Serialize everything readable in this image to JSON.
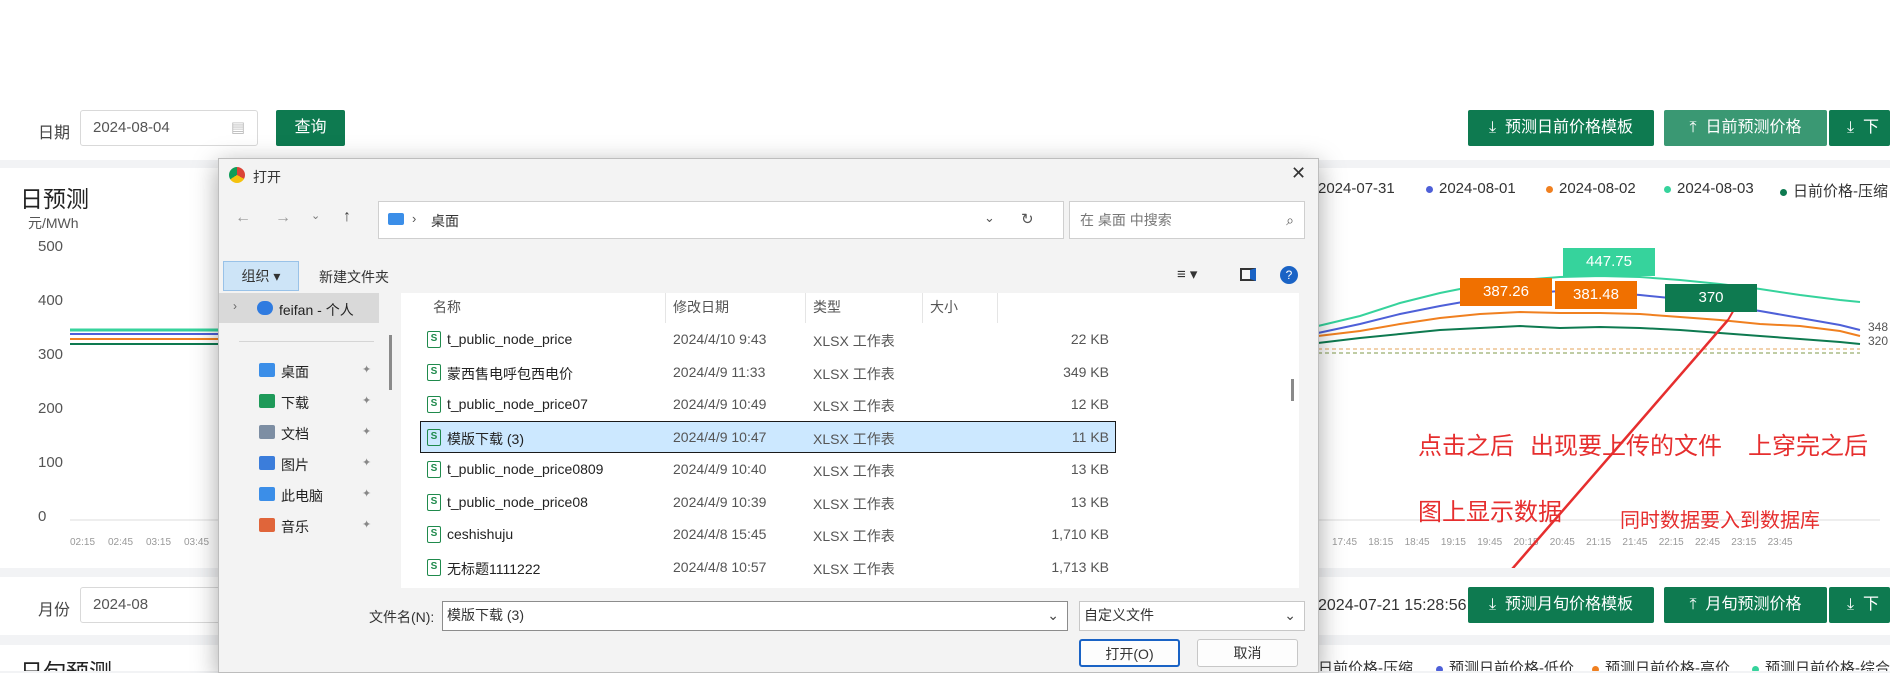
{
  "top": {
    "date_label": "日期",
    "date_value": "2024-08-04",
    "query_label": "查询",
    "btn_template": "预测日前价格模板",
    "btn_predict": "日前预测价格",
    "btn_more": "下"
  },
  "chart1": {
    "title": "日预测",
    "unit": "元/MWh",
    "y_ticks": [
      "500",
      "400",
      "300",
      "200",
      "100",
      "0"
    ],
    "x_ticks_left": [
      "02:15",
      "02:45",
      "03:15",
      "03:45"
    ],
    "x_ticks_right": [
      "17:45",
      "18:15",
      "18:45",
      "19:15",
      "19:45",
      "20:15",
      "20:45",
      "21:15",
      "21:45",
      "22:15",
      "22:45",
      "23:15",
      "23:45"
    ],
    "right_values": [
      "348",
      "320"
    ],
    "legend": [
      {
        "name": "2024-07-31",
        "color": "#4e60d8"
      },
      {
        "name": "2024-08-01",
        "color": "#4e60d8"
      },
      {
        "name": "2024-08-02",
        "color": "#f08020"
      },
      {
        "name": "2024-08-03",
        "color": "#36d39c"
      },
      {
        "name": "日前价格-压缩",
        "color": "#0e7a50"
      }
    ],
    "tags": [
      "447.75",
      "387.26",
      "381.48",
      "370"
    ]
  },
  "annotations": {
    "line1_a": "点击之后",
    "line1_b": "出现要上传的文件",
    "line1_c": "上穿完之后",
    "line2_a": "图上显示数据",
    "line2_b": "同时数据要入到数据库"
  },
  "month_row": {
    "label": "月份",
    "value": "2024-08",
    "timestamp": "2024-07-21 15:28:56",
    "btn_template": "预测月旬价格模板",
    "btn_predict": "月旬预测价格",
    "btn_more": "下"
  },
  "chart2": {
    "title": "日旬预测",
    "legend_partial": [
      "日前价格-压缩",
      "预测日前价格-低价",
      "预测日前价格-高价",
      "预测日前价格-综合"
    ]
  },
  "dialog": {
    "title": "打开",
    "breadcrumb": "桌面",
    "search_placeholder": "在 桌面 中搜索",
    "organize": "组织 ▾",
    "new_folder": "新建文件夹",
    "cols": {
      "name": "名称",
      "modified": "修改日期",
      "type": "类型",
      "size": "大小"
    },
    "nav": [
      {
        "label": "feifan - 个人",
        "color": "#2f7be0"
      },
      {
        "label": "桌面",
        "color": "#3b8ee8"
      },
      {
        "label": "下载",
        "color": "#1e9a59"
      },
      {
        "label": "文档",
        "color": "#7d8ea3"
      },
      {
        "label": "图片",
        "color": "#3b7ddb"
      },
      {
        "label": "此电脑",
        "color": "#3b8ee8"
      },
      {
        "label": "音乐",
        "color": "#e0653a"
      }
    ],
    "files": [
      {
        "name": "t_public_node_price",
        "date": "2024/4/10 9:43",
        "type": "XLSX 工作表",
        "size": "22 KB"
      },
      {
        "name": "蒙西售电呼包西电价",
        "date": "2024/4/9 11:33",
        "type": "XLSX 工作表",
        "size": "349 KB"
      },
      {
        "name": "t_public_node_price07",
        "date": "2024/4/9 10:49",
        "type": "XLSX 工作表",
        "size": "12 KB"
      },
      {
        "name": "模版下载 (3)",
        "date": "2024/4/9 10:47",
        "type": "XLSX 工作表",
        "size": "11 KB"
      },
      {
        "name": "t_public_node_price0809",
        "date": "2024/4/9 10:40",
        "type": "XLSX 工作表",
        "size": "13 KB"
      },
      {
        "name": "t_public_node_price08",
        "date": "2024/4/9 10:39",
        "type": "XLSX 工作表",
        "size": "13 KB"
      },
      {
        "name": "ceshishuju",
        "date": "2024/4/8 15:45",
        "type": "XLSX 工作表",
        "size": "1,710 KB"
      },
      {
        "name": "无标题1111222",
        "date": "2024/4/8 10:57",
        "type": "XLSX 工作表",
        "size": "1,713 KB"
      }
    ],
    "filename_label": "文件名(N):",
    "filename_value": "模版下载 (3)",
    "filetype_value": "自定义文件",
    "open_label": "打开(O)",
    "cancel_label": "取消"
  }
}
